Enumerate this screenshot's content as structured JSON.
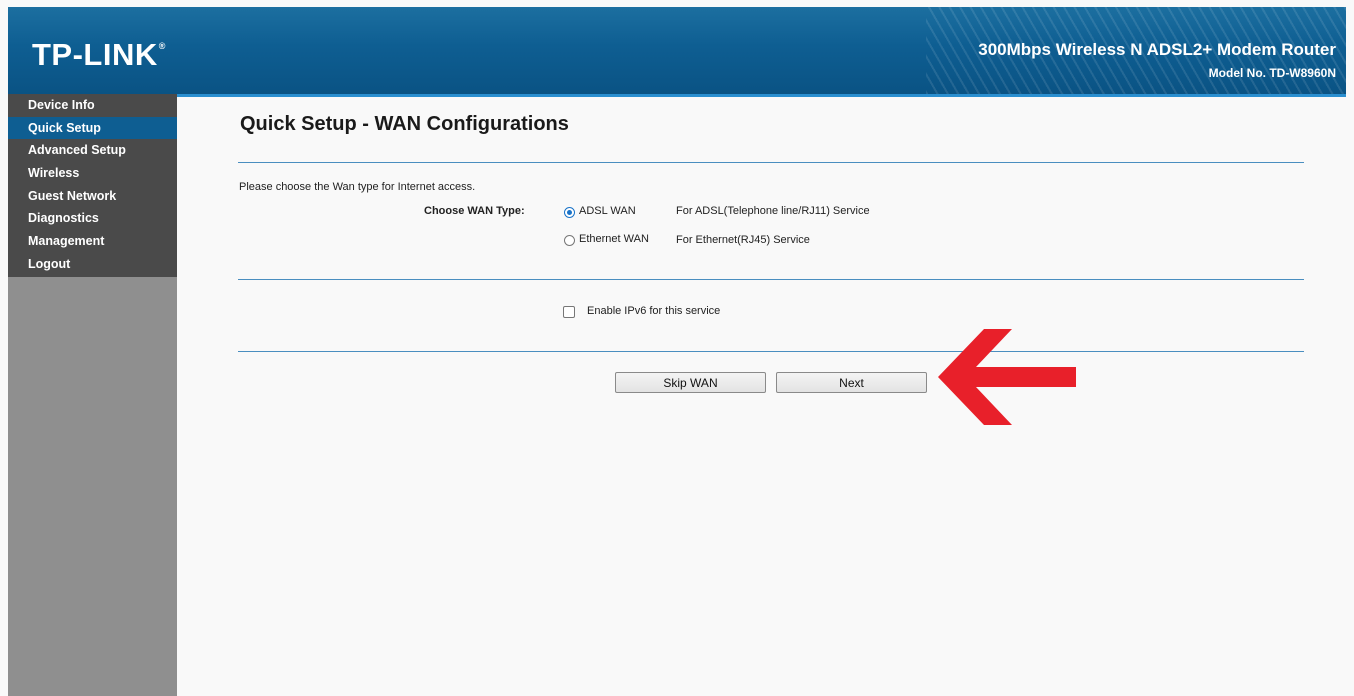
{
  "header": {
    "logo": "TP-LINK",
    "logo_mark": "®",
    "product": "300Mbps Wireless N ADSL2+ Modem Router",
    "model": "Model No. TD-W8960N"
  },
  "sidebar": {
    "items": [
      {
        "label": "Device Info"
      },
      {
        "label": "Quick Setup",
        "active": true
      },
      {
        "label": "Advanced Setup"
      },
      {
        "label": "Wireless"
      },
      {
        "label": "Guest Network"
      },
      {
        "label": "Diagnostics"
      },
      {
        "label": "Management"
      },
      {
        "label": "Logout"
      }
    ]
  },
  "main": {
    "title": "Quick Setup - WAN Configurations",
    "instruction": "Please choose the Wan type for Internet access.",
    "wan_type_label": "Choose WAN Type:",
    "options": [
      {
        "label": "ADSL WAN",
        "description": "For ADSL(Telephone line/RJ11) Service",
        "checked": true
      },
      {
        "label": "Ethernet WAN",
        "description": "For Ethernet(RJ45) Service",
        "checked": false
      }
    ],
    "ipv6_label": "Enable IPv6 for this service",
    "ipv6_checked": false,
    "buttons": {
      "skip": "Skip WAN",
      "next": "Next"
    }
  },
  "colors": {
    "header": "#0e5e92",
    "sidebar_menu": "#4a4a4a",
    "sidebar_active": "#0e5e92",
    "sidebar_fill": "#8f8f8f",
    "divider": "#4a8ec0",
    "annotation_arrow": "#e8202a"
  },
  "icons": {
    "annotation": "red-left-arrow-icon"
  }
}
